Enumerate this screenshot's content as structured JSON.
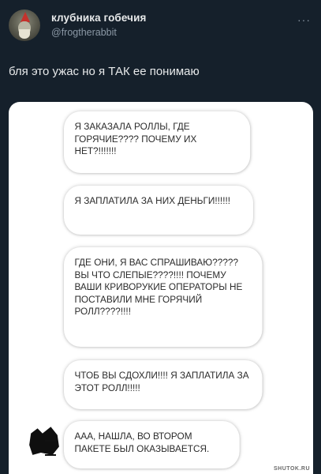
{
  "author": {
    "display_name": "клубника гобечия",
    "handle": "@frogtherabbit"
  },
  "more_icon": "more-horizontal-icon",
  "tweet": {
    "text": "бля это ужас но я ТАК ее понимаю"
  },
  "chat": {
    "messages": [
      "Я ЗАКАЗАЛА РОЛЛЫ, ГДЕ ГОРЯЧИЕ???? ПОЧЕМУ ИХ НЕТ?!!!!!!!",
      "Я ЗАПЛАТИЛА ЗА НИХ ДЕНЬГИ!!!!!!",
      "ГДЕ ОНИ, Я ВАС СПРАШИВАЮ????? ВЫ ЧТО СЛЕПЫЕ????!!!! ПОЧЕМУ ВАШИ КРИВОРУКИЕ ОПЕРАТОРЫ НЕ ПОСТАВИЛИ МНЕ ГОРЯЧИЙ РОЛЛ????!!!!",
      "ЧТОБ ВЫ СДОХЛИ!!!! Я ЗАПЛАТИЛА ЗА ЭТОТ РОЛЛ!!!!!",
      "ААА, НАШЛА, ВО ВТОРОМ ПАКЕТЕ БЫЛ ОКАЗЫВАЕТСЯ."
    ]
  },
  "watermark": "SHUTOK.RU"
}
